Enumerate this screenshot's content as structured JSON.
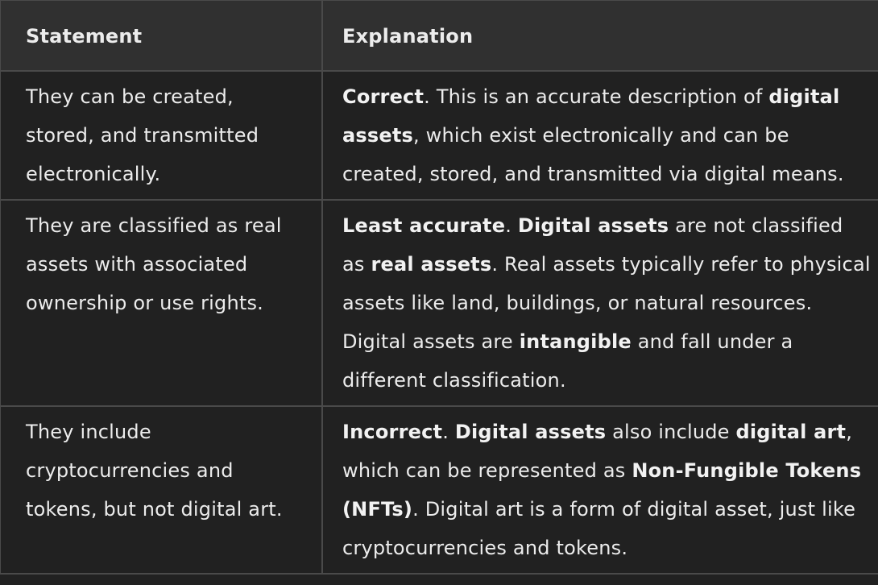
{
  "table": {
    "headers": [
      "Statement",
      "Explanation"
    ],
    "rows": [
      {
        "statement": "They can be created, stored, and transmitted electronically.",
        "explanation": [
          {
            "t": "Correct",
            "b": true
          },
          {
            "t": ". This is an accurate description of ",
            "b": false
          },
          {
            "t": "digital assets",
            "b": true
          },
          {
            "t": ", which exist electronically and can be created, stored, and transmitted via digital means.",
            "b": false
          }
        ]
      },
      {
        "statement": "They are classified as real assets with associated ownership or use rights.",
        "explanation": [
          {
            "t": "Least accurate",
            "b": true
          },
          {
            "t": ". ",
            "b": false
          },
          {
            "t": "Digital assets",
            "b": true
          },
          {
            "t": " are not classified as ",
            "b": false
          },
          {
            "t": "real assets",
            "b": true
          },
          {
            "t": ". Real assets typically refer to physical assets like land, buildings, or natural resources. Digital assets are ",
            "b": false
          },
          {
            "t": "intangible",
            "b": true
          },
          {
            "t": " and fall under a different classification.",
            "b": false
          }
        ]
      },
      {
        "statement": "They include cryptocurrencies and tokens, but not digital art.",
        "explanation": [
          {
            "t": "Incorrect",
            "b": true
          },
          {
            "t": ". ",
            "b": false
          },
          {
            "t": "Digital assets",
            "b": true
          },
          {
            "t": " also include ",
            "b": false
          },
          {
            "t": "digital art",
            "b": true
          },
          {
            "t": ", which can be represented as ",
            "b": false
          },
          {
            "t": "Non-Fungible Tokens (NFTs)",
            "b": true
          },
          {
            "t": ". Digital art is a form of digital asset, just like cryptocurrencies and tokens.",
            "b": false
          }
        ]
      }
    ]
  }
}
